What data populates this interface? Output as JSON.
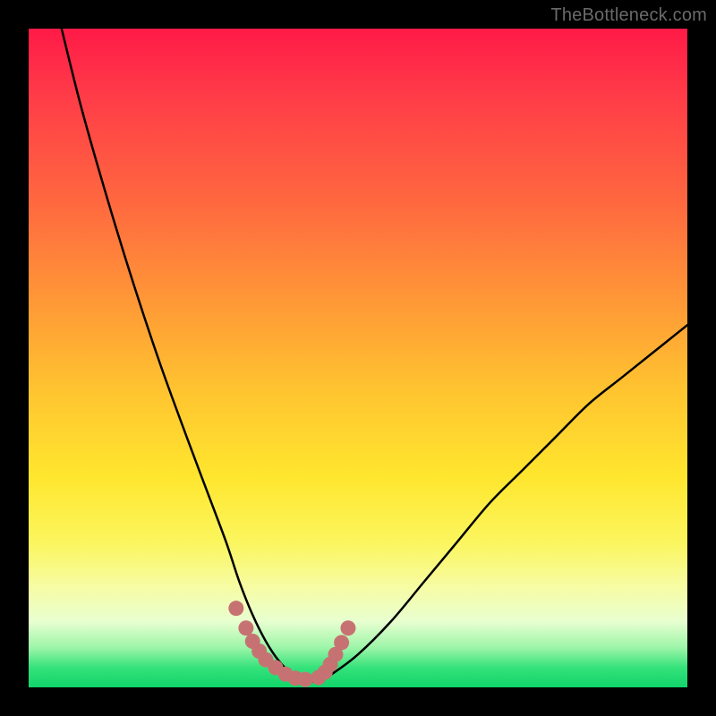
{
  "watermark": "TheBottleneck.com",
  "colors": {
    "frame": "#000000",
    "curve": "#000000",
    "marker": "#c77272",
    "gradient_top": "#ff1a47",
    "gradient_bottom": "#10d46a"
  },
  "chart_data": {
    "type": "line",
    "title": "",
    "xlabel": "",
    "ylabel": "",
    "xlim": [
      0,
      100
    ],
    "ylim": [
      0,
      100
    ],
    "grid": false,
    "legend": false,
    "series": [
      {
        "name": "bottleneck-curve",
        "x": [
          5,
          8,
          12,
          16,
          20,
          24,
          27,
          30,
          32,
          34,
          36,
          38,
          40,
          42,
          44,
          46,
          50,
          55,
          60,
          65,
          70,
          75,
          80,
          85,
          90,
          95,
          100
        ],
        "y": [
          100,
          88,
          74,
          61,
          49,
          38,
          30,
          22,
          16,
          11,
          7,
          4,
          2,
          1,
          1,
          2,
          5,
          10,
          16,
          22,
          28,
          33,
          38,
          43,
          47,
          51,
          55
        ]
      }
    ],
    "markers": {
      "name": "highlight-dots",
      "x": [
        31.5,
        33.0,
        34.0,
        35.0,
        36.0,
        37.5,
        39.0,
        40.5,
        42.0,
        44.0,
        45.0,
        45.8,
        46.6,
        47.5,
        48.5
      ],
      "y": [
        12.0,
        9.0,
        7.0,
        5.5,
        4.2,
        3.0,
        2.0,
        1.4,
        1.2,
        1.5,
        2.3,
        3.5,
        5.0,
        6.8,
        9.0
      ]
    }
  }
}
